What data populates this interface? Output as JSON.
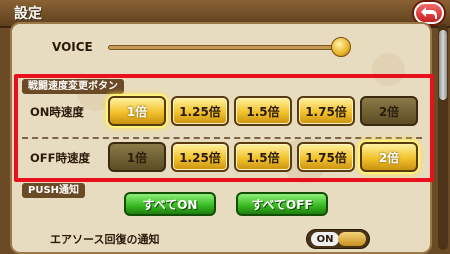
{
  "header": {
    "title": "設定"
  },
  "voice": {
    "label": "VOICE",
    "level": 1.0
  },
  "speed_section": {
    "title": "戦闘速度変更ボタン",
    "on_row": {
      "label": "ON時速度",
      "buttons": [
        "1倍",
        "1.25倍",
        "1.5倍",
        "1.75倍",
        "2倍"
      ],
      "selected": "1倍"
    },
    "off_row": {
      "label": "OFF時速度",
      "buttons": [
        "1倍",
        "1.25倍",
        "1.5倍",
        "1.75倍",
        "2倍"
      ],
      "selected": "2倍"
    }
  },
  "push": {
    "title": "PUSH通知",
    "all_on": "すべてON",
    "all_off": "すべてOFF",
    "stamina_label": "エアソース回復の通知",
    "stamina_toggle": "ON"
  },
  "colors": {
    "highlight": "#e8101a",
    "accent_gold": "#f2c22c",
    "accent_green": "#35b81e"
  }
}
